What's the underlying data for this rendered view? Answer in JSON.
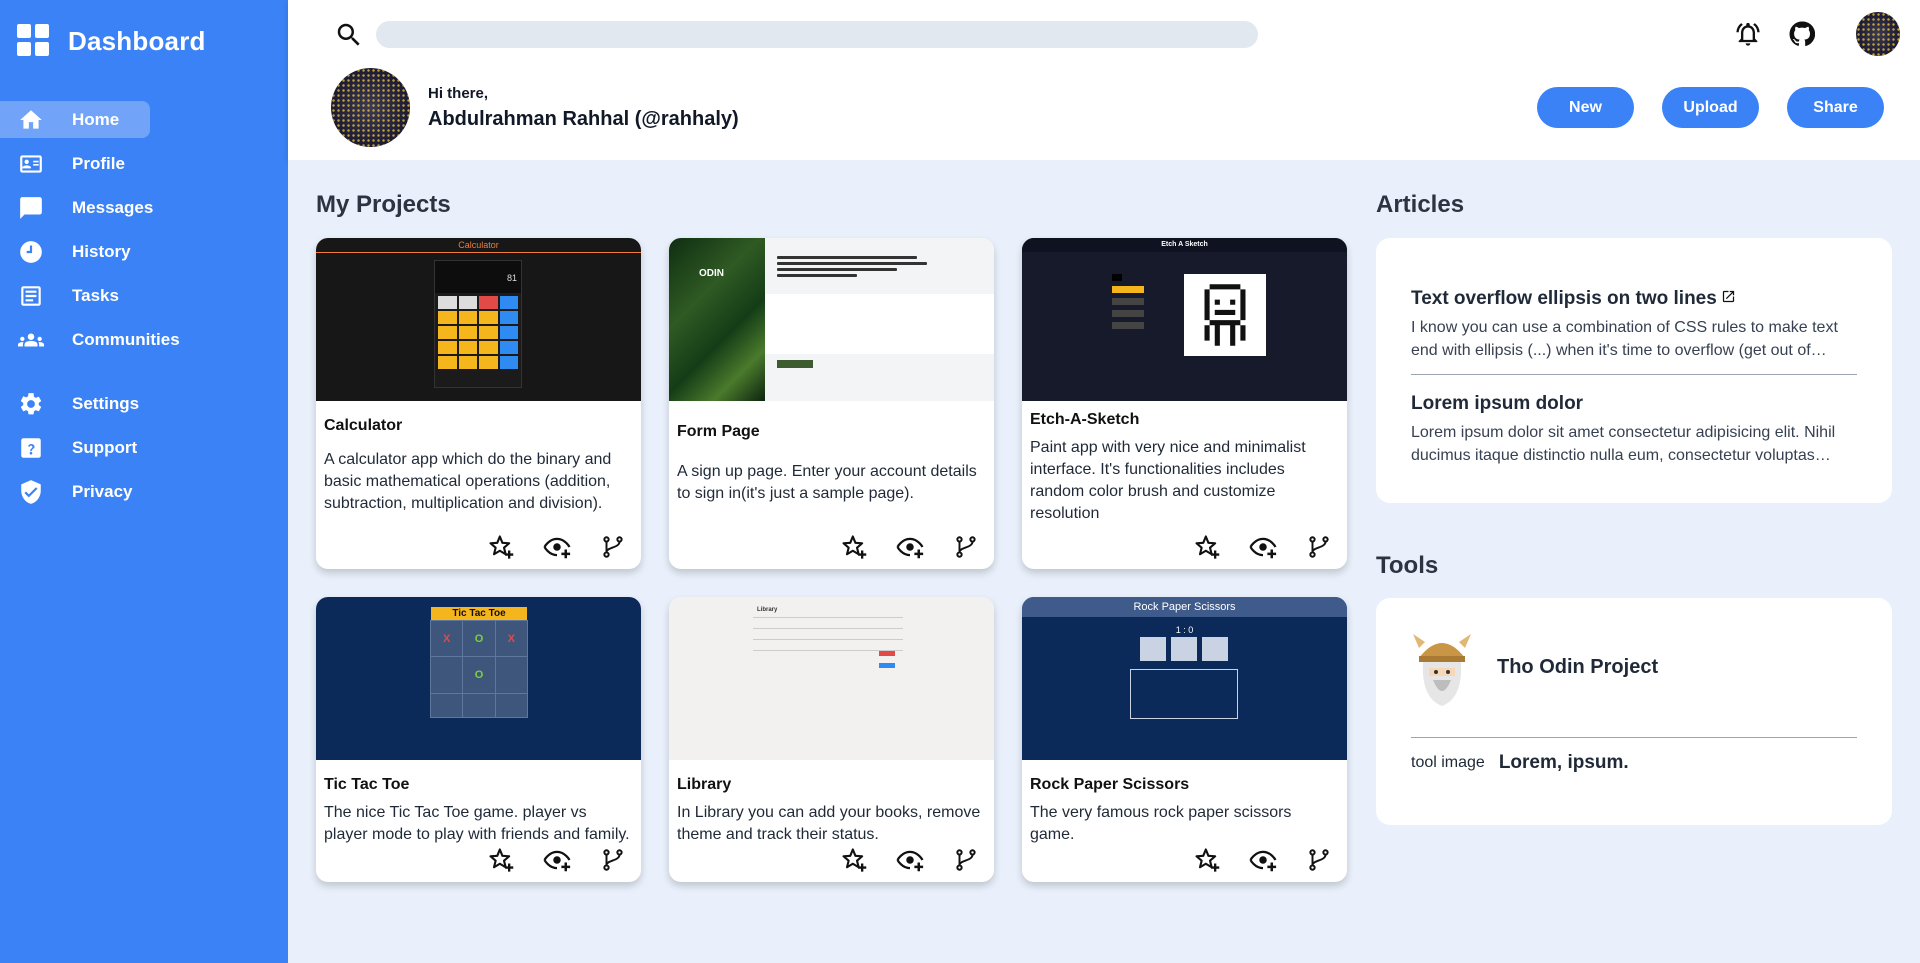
{
  "sidebar": {
    "brand": "Dashboard",
    "items": [
      {
        "label": "Home",
        "icon": "home-icon"
      },
      {
        "label": "Profile",
        "icon": "profile-card-icon"
      },
      {
        "label": "Messages",
        "icon": "message-icon"
      },
      {
        "label": "History",
        "icon": "clock-icon"
      },
      {
        "label": "Tasks",
        "icon": "tasks-icon"
      },
      {
        "label": "Communities",
        "icon": "people-icon"
      },
      {
        "label": "Settings",
        "icon": "gear-icon"
      },
      {
        "label": "Support",
        "icon": "help-icon"
      },
      {
        "label": "Privacy",
        "icon": "shield-icon"
      }
    ]
  },
  "header": {
    "search": {
      "placeholder": "",
      "value": ""
    },
    "greeting": "Hi there,",
    "username": "Abdulrahman Rahhal (@rahhaly)",
    "buttons": {
      "new": "New",
      "upload": "Upload",
      "share": "Share"
    }
  },
  "projects": {
    "title": "My Projects",
    "items": [
      {
        "title": "Calculator",
        "description": "A calculator app which do the binary and basic mathematical operations (addition, subtraction, multiplication and division).",
        "thumb_caption": "Calculator"
      },
      {
        "title": "Form Page",
        "description": "A sign up page. Enter your account details to sign in(it's just a sample page).",
        "thumb_caption": "ODIN"
      },
      {
        "title": "Etch-A-Sketch",
        "description": "Paint app with very nice and minimalist interface. It's functionalities includes random color brush and customize resolution",
        "thumb_caption": "Etch A Sketch"
      },
      {
        "title": "Tic Tac Toe",
        "description": "The nice Tic Tac Toe game. player vs player mode to play with friends and family.",
        "thumb_caption": "Tic Tac Toe"
      },
      {
        "title": "Library",
        "description": "In Library you can add your books, remove theme and track their status.",
        "thumb_caption": "Library"
      },
      {
        "title": "Rock Paper Scissors",
        "description": "The very famous rock paper scissors game.",
        "thumb_caption": "Rock Paper Scissors",
        "thumb_score": "1 : 0"
      }
    ]
  },
  "articles": {
    "title": "Articles",
    "items": [
      {
        "title": "Text overflow ellipsis on two lines",
        "text": "I know you can use a combination of CSS rules to make text end with ellipsis (...) when it's time to overflow (get out of parent's bounds)."
      },
      {
        "title": "Lorem ipsum dolor",
        "text": "Lorem ipsum dolor sit amet consectetur adipisicing elit. Nihil ducimus itaque distinctio nulla eum, consectetur voluptas quibusdam."
      }
    ]
  },
  "tools": {
    "title": "Tools",
    "name": "Tho Odin Project",
    "image_alt": "tool image",
    "subtitle": "Lorem, ipsum."
  },
  "colors": {
    "accent": "#3b82f6",
    "background": "#e9f0fb"
  }
}
